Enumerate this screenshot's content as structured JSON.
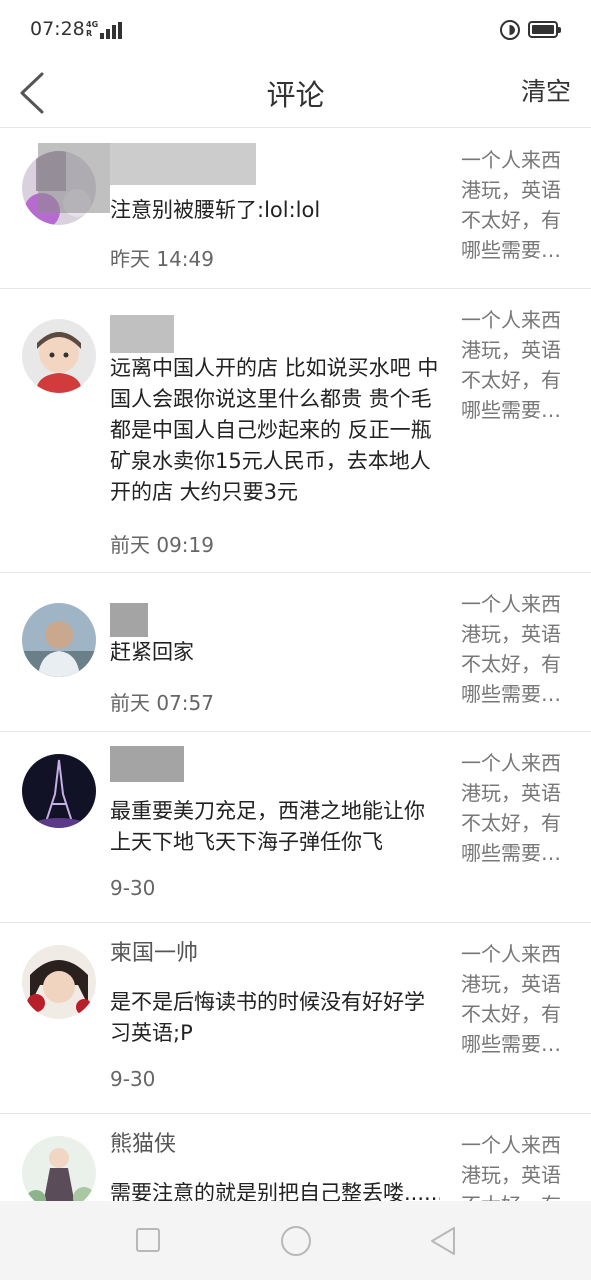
{
  "status_bar": {
    "time": "07:28",
    "network_type": "4G",
    "network_roaming": "R",
    "icons": [
      "signal-icon",
      "do-not-disturb-icon",
      "battery-icon"
    ]
  },
  "header": {
    "back_icon": "chevron-left-icon",
    "title": "评论",
    "clear_label": "清空"
  },
  "comments": [
    {
      "user": "",
      "avatar": "blurred-avatar",
      "text": "注意别被腰斩了:lol:lol",
      "time": "昨天 14:49",
      "post_excerpt": "一个人来西港玩，英语不太好，有哪些需要…"
    },
    {
      "user": "",
      "avatar": "cartoon-avatar",
      "text": "远离中国人开的店 比如说买水吧 中国人会跟你说这里什么都贵  贵个毛 都是中国人自己炒起来的 反正一瓶矿泉水卖你15元人民币，去本地人开的店 大约只要3元",
      "time": "前天 09:19",
      "post_excerpt": "一个人来西港玩，英语不太好，有哪些需要…"
    },
    {
      "user": "",
      "avatar": "photo-avatar",
      "text": "赶紧回家",
      "time": "前天 07:57",
      "post_excerpt": "一个人来西港玩，英语不太好，有哪些需要…"
    },
    {
      "user": "",
      "avatar": "eiffel-tower-avatar",
      "text": "最重要美刀充足，西港之地能让你上天下地飞天下海子弹任你飞",
      "time": "9-30",
      "post_excerpt": "一个人来西港玩，英语不太好，有哪些需要…"
    },
    {
      "user": "柬国一帅",
      "avatar": "anime-avatar",
      "text": "是不是后悔读书的时候没有好好学习英语;P",
      "time": "9-30",
      "post_excerpt": "一个人来西港玩，英语不太好，有哪些需要…"
    },
    {
      "user": "熊猫侠",
      "avatar": "girl-avatar",
      "text": "需要注意的就是别把自己整丢喽......",
      "time": "",
      "post_excerpt": "一个人来西港玩，英语不太好，有哪些需要…"
    }
  ],
  "nav_bar": {
    "icons": [
      "recent-apps-icon",
      "home-icon",
      "back-icon"
    ]
  }
}
